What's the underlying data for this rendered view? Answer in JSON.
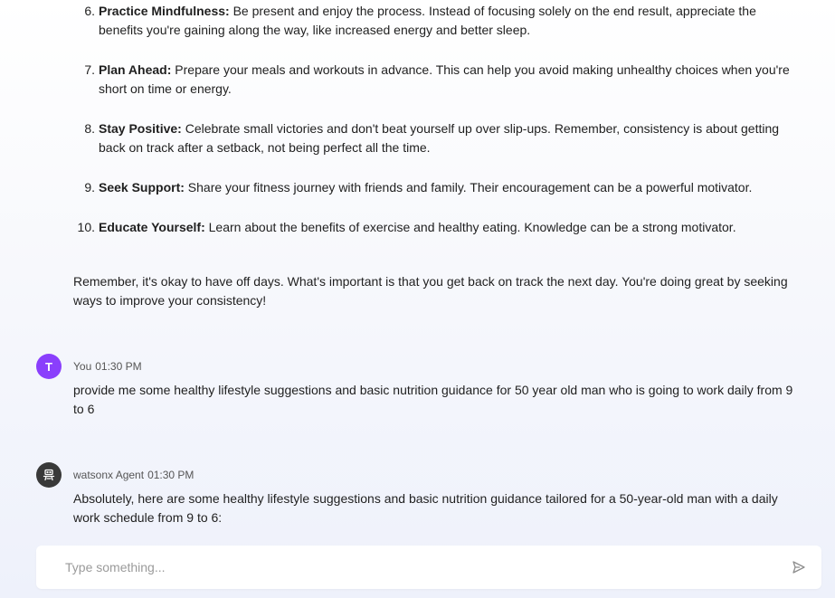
{
  "conversation": {
    "tips": [
      {
        "number": "6.",
        "title": "Practice Mindfulness:",
        "text": " Be present and enjoy the process. Instead of focusing solely on the end result, appreciate the benefits you're gaining along the way, like increased energy and better sleep."
      },
      {
        "number": "7.",
        "title": "Plan Ahead:",
        "text": " Prepare your meals and workouts in advance. This can help you avoid making unhealthy choices when you're short on time or energy."
      },
      {
        "number": "8.",
        "title": "Stay Positive:",
        "text": " Celebrate small victories and don't beat yourself up over slip-ups. Remember, consistency is about getting back on track after a setback, not being perfect all the time."
      },
      {
        "number": "9.",
        "title": "Seek Support:",
        "text": " Share your fitness journey with friends and family. Their encouragement can be a powerful motivator."
      },
      {
        "number": "10.",
        "title": "Educate Yourself:",
        "text": " Learn about the benefits of exercise and healthy eating. Knowledge can be a strong motivator."
      }
    ],
    "closing": "Remember, it's okay to have off days. What's important is that you get back on track the next day. You're doing great by seeking ways to improve your consistency!",
    "user_message": {
      "avatar_letter": "T",
      "avatar_color": "#8a3ffc",
      "sender": "You",
      "time": "01:30 PM",
      "text": "provide me some healthy lifestyle suggestions and basic nutrition guidance for 50 year old man who is going to work daily from 9 to 6"
    },
    "agent_message": {
      "avatar_icon": "robot-icon",
      "avatar_color": "#393939",
      "sender": "watsonx Agent",
      "time": "01:30 PM",
      "text": "Absolutely, here are some healthy lifestyle suggestions and basic nutrition guidance tailored for a 50-year-old man with a daily work schedule from 9 to 6:"
    }
  },
  "composer": {
    "placeholder": "Type something...",
    "send_icon": "send-icon"
  }
}
